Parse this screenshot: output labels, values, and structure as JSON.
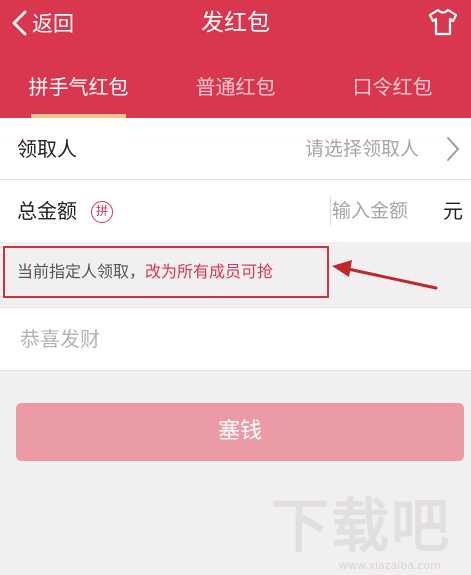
{
  "header": {
    "back_label": "返回",
    "title": "发红包",
    "bg_color": "#d9374f"
  },
  "tabs": [
    {
      "label": "拼手气红包",
      "active": true
    },
    {
      "label": "普通红包",
      "active": false
    },
    {
      "label": "口令红包",
      "active": false
    }
  ],
  "recipient": {
    "label": "领取人",
    "value_placeholder": "请选择领取人"
  },
  "amount": {
    "label": "总金额",
    "badge": "拼",
    "placeholder": "输入金额",
    "unit": "元"
  },
  "hint": {
    "text": "当前指定人领取，",
    "link": "改为所有成员可抢"
  },
  "wish": {
    "placeholder": "恭喜发财"
  },
  "submit": {
    "label": "塞钱",
    "color": "#eb9ba6"
  },
  "watermark": {
    "text": "下载吧",
    "sub": "www.xiazaiba.com"
  }
}
